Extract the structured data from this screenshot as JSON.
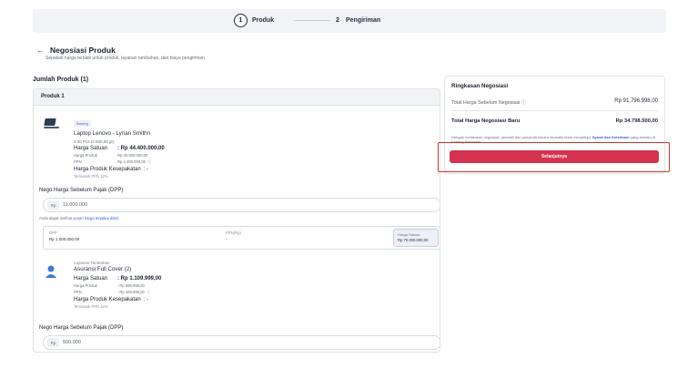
{
  "stepper": {
    "steps": [
      {
        "number": "1",
        "label": "Produk"
      },
      {
        "number": "2",
        "label": "Pengiriman"
      }
    ]
  },
  "header": {
    "title": "Negosiasi Produk",
    "subtitle": "Sepakati harga terbaik untuk produk, layanan tambahan, dan biaya pengiriman."
  },
  "product_count": "Jumlah Produk (1)",
  "product_card": {
    "title": "Produk 1",
    "items": [
      {
        "badge": "Barang",
        "name": "Laptop Lenovo - Lynan Smithn",
        "qty": "2.00 Pcs (2.000,00 gr)",
        "unit_price_label": "Harga Satuan",
        "unit_price": ": Rp 44.400.000,00",
        "product_price_label": "Harga Produk",
        "product_price": "Rp 40.000.000,00",
        "ppn_label": "PPN",
        "ppn": "Rp 4.400.000,00",
        "agreed_label": "Harga Produk Kesepakatan",
        "agreed_value": ": -",
        "note": "Termasuk PPN 12%"
      },
      {
        "tag": "Layanan Tambahan",
        "name": "Asuransi Full Cover (2)",
        "unit_price_label": "Harga Satuan",
        "unit_price": ": Rp 1.109.999,00",
        "product_price_label": "Harga Produk",
        "product_price": ": Rp 999.999,00",
        "ppn_label": "PPN",
        "ppn": ": Rp 109.999,00",
        "agreed_label": "Harga Produk Kesepakatan",
        "agreed_value": ": -",
        "note": "Termasuk PPN 12%"
      }
    ],
    "dpp_label": "Nego Harga Sebelum Pajak (DPP)",
    "dpp_prefix": "Rp",
    "dpp_value_1": "11.000.000",
    "hint_prefix": "Anda dapat melihat",
    "hint_link": "acuan harga terpakai disini.",
    "breakdown": {
      "dpp_key": "DPP",
      "dpp_value": "Rp 1.000.000,00",
      "ppn_key": "PPN(Rp)",
      "ppn_value": "-",
      "unit_key": "Harga Satuan",
      "unit_value": "Rp 70.000.000,00"
    },
    "dpp_value_2": "500.000"
  },
  "summary": {
    "title": "Ringkasan Negosiasi",
    "before_label": "Total Harga Sebelum Negosiasi",
    "before_value": "Rp 91.796.998,00",
    "after_label": "Total Harga Negosiasi Baru",
    "after_value": "Rp 34.798.500,00",
    "disclaimer_1": "Dengan melakukan negosiasi, pembeli dan penyedia secara otomatis telah menyetujui",
    "disclaimer_link": "Syarat dan Ketentuan",
    "disclaimer_2": "yang berlaku di Katalog Elektronik",
    "next_button": "Selanjutnya"
  },
  "colors": {
    "primary": "#d4324e",
    "highlight": "#d93030",
    "link": "#3b5bd6"
  }
}
